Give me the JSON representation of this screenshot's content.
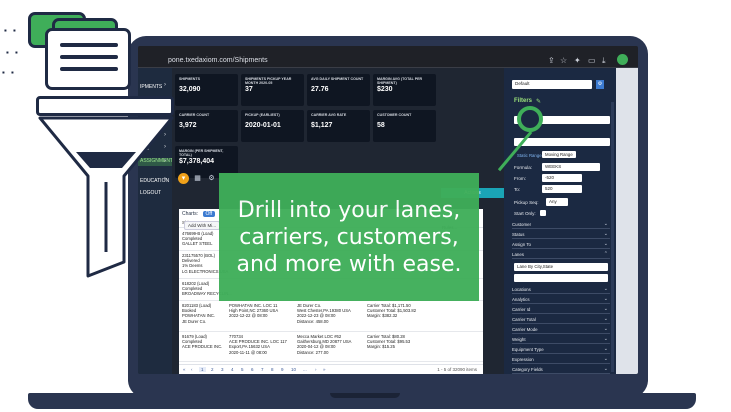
{
  "browser": {
    "url": "pone.txedaxiom.com/Shipments",
    "url_fragment_left": "om.com"
  },
  "sidebar": {
    "items": [
      {
        "label": "IPMENTS",
        "active": false
      },
      {
        "label": "IMS",
        "active": false
      },
      {
        "label": "ASSIGNMENTS",
        "active": true
      },
      {
        "label": "EDUCATION",
        "active": false
      },
      {
        "label": "LOGOUT",
        "active": false
      }
    ]
  },
  "metrics": [
    {
      "label": "SHIPMENTS",
      "value": "32,090"
    },
    {
      "label": "SHIPMENTS PICKUP YEAR MONTH 2020-05",
      "value": "37"
    },
    {
      "label": "AVG DAILY SHIPMENT COUNT",
      "value": "27.76"
    },
    {
      "label": "MARGIN AVG (TOTAL PER SHIPMENT)",
      "value": "$230"
    },
    {
      "label": "CARRIER COUNT",
      "value": "3,972"
    },
    {
      "label": "PICKUP (EARLIEST)",
      "value": "2020-01-01"
    },
    {
      "label": "CARRIER AVG RATE",
      "value": "$1,127"
    },
    {
      "label": "CUSTOMER COUNT",
      "value": "58"
    },
    {
      "label": "MARGIN (PER SHIPMENT, TOTAL)",
      "value": "$7,378,404"
    }
  ],
  "charts_bar": {
    "label": "Charts:",
    "toggle": "Off"
  },
  "add_widget": "Add With Mi...",
  "actions_label": "Actions",
  "table": {
    "header": "Shipment Summ...",
    "rows": [
      {
        "c1": "476699-B (Load)\nCompleted\nGALLET STEEL",
        "c2": "",
        "c3": ""
      },
      {
        "c1": "231175570 (BOL)\nDelivered\n1% Deems\nLG ELECTRONICS USA",
        "c2": "",
        "c3": ""
      },
      {
        "c1": "618202 (Load)\nCompleted\nBROADWAY RECYCLIN...",
        "c2": "",
        "c3": ""
      },
      {
        "c1": "8201183 (Load)\nBooked\nPOWHATAN INC.\nJE Durer Co.",
        "c2": "POWHATAN INC. LOC 11\nHigh Point,NC 27360 USA\n2022-12-22 @ 08:00",
        "c3": "JE Durer Co.\nWest Chester,PA 19380 USA\n2022-12-23 @ 08:00\nDistance: 458.00",
        "c4": "Carrier Total: $1,171.50\nCustomer Total: $1,503.82\nMargin: $382.32"
      },
      {
        "c1": "91679 (Load)\nCompleted\nACE PRODUCE INC.",
        "c2": "770734\nACE PRODUCE INC. LOC 117\nExport,PA 15632 USA\n2020-11-11 @ 08:00",
        "c3": "Mecca Market LOC #62\nGaithersburg,MD 20877 USA\n2020-04-12 @ 08:00\nDistance: 277.00",
        "c4": "Carrier Total: $80.28\nCustomer Total: $95.53\nMargin: $15.25"
      }
    ],
    "pager": [
      "«",
      "‹",
      "1",
      "2",
      "3",
      "4",
      "5",
      "6",
      "7",
      "8",
      "9",
      "10",
      "...",
      "›",
      "»"
    ],
    "count": "1 - 5 of 32090 items",
    "extra_rules": "Rules..."
  },
  "filters": {
    "view_select": "Default",
    "title": "Filters",
    "static_range": "Static Range",
    "moving_range": "Moving Range",
    "formula_label": "Formula:",
    "formula_value": "WEEKS",
    "from_label": "From:",
    "from_value": "-520",
    "to_label": "To:",
    "to_value": "520",
    "pickup_seq_label": "Pickup Seq:",
    "pickup_seq_value": "Any",
    "start_only_label": "Start Only:",
    "sections_top": [
      "Customer",
      "Status",
      "Assign To",
      "Lanes"
    ],
    "lanes_select": "Lane By City,State",
    "sections_bottom": [
      "Locations",
      "Analytics",
      "Carrier Id",
      "Carrier Total",
      "Carrier Mode",
      "Weight",
      "Equipment Type",
      "Expression",
      "Category Fields"
    ]
  },
  "callout": {
    "text": "Drill into your lanes, carriers, customers, and more with ease."
  },
  "colors": {
    "brand_green": "#3fae59",
    "navy": "#1f2a44",
    "panel": "#1b2942"
  }
}
